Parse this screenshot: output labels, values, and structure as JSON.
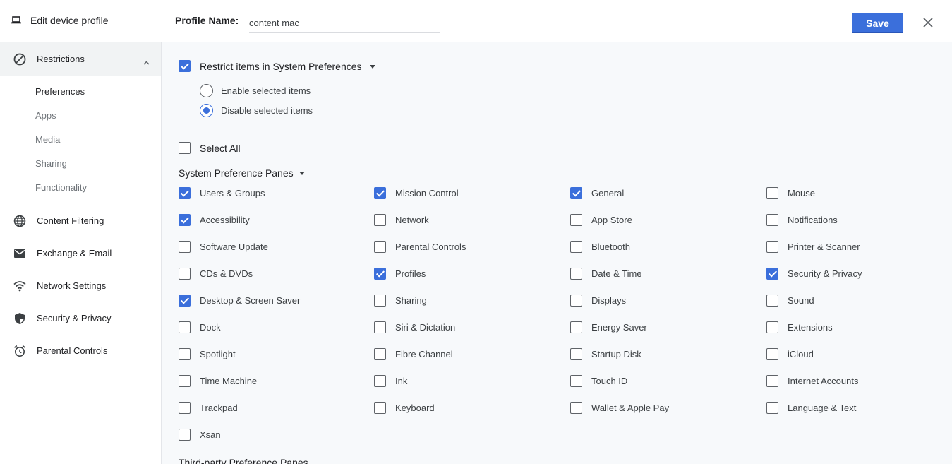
{
  "header": {
    "title": "Edit device profile",
    "profile_name_label": "Profile Name:",
    "profile_name_value": "content mac",
    "save_label": "Save"
  },
  "sidebar": {
    "section": "Restrictions",
    "sub_items": [
      "Preferences",
      "Apps",
      "Media",
      "Sharing",
      "Functionality"
    ],
    "active_sub_item": "Preferences",
    "items": [
      {
        "label": "Content Filtering",
        "icon": "globe-icon"
      },
      {
        "label": "Exchange & Email",
        "icon": "mail-icon"
      },
      {
        "label": "Network Settings",
        "icon": "wifi-icon"
      },
      {
        "label": "Security & Privacy",
        "icon": "shield-icon"
      },
      {
        "label": "Parental Controls",
        "icon": "alarm-clock-icon"
      }
    ]
  },
  "main": {
    "restrict_label": "Restrict items in System Preferences",
    "restrict_checked": true,
    "radio_options": [
      {
        "label": "Enable selected items",
        "selected": false
      },
      {
        "label": "Disable selected items",
        "selected": true
      }
    ],
    "select_all_label": "Select All",
    "select_all_checked": false,
    "system_panes_title": "System Preference Panes",
    "panes": [
      [
        "Users & Groups",
        true
      ],
      [
        "Mission Control",
        true
      ],
      [
        "General",
        true
      ],
      [
        "Mouse",
        false
      ],
      [
        "Accessibility",
        true
      ],
      [
        "Network",
        false
      ],
      [
        "App Store",
        false
      ],
      [
        "Notifications",
        false
      ],
      [
        "Software Update",
        false
      ],
      [
        "Parental Controls",
        false
      ],
      [
        "Bluetooth",
        false
      ],
      [
        "Printer & Scanner",
        false
      ],
      [
        "CDs & DVDs",
        false
      ],
      [
        "Profiles",
        true
      ],
      [
        "Date & Time",
        false
      ],
      [
        "Security & Privacy",
        true
      ],
      [
        "Desktop & Screen Saver",
        true
      ],
      [
        "Sharing",
        false
      ],
      [
        "Displays",
        false
      ],
      [
        "Sound",
        false
      ],
      [
        "Dock",
        false
      ],
      [
        "Siri & Dictation",
        false
      ],
      [
        "Energy Saver",
        false
      ],
      [
        "Extensions",
        false
      ],
      [
        "Spotlight",
        false
      ],
      [
        "Fibre Channel",
        false
      ],
      [
        "Startup Disk",
        false
      ],
      [
        "iCloud",
        false
      ],
      [
        "Time Machine",
        false
      ],
      [
        "Ink",
        false
      ],
      [
        "Touch ID",
        false
      ],
      [
        "Internet Accounts",
        false
      ],
      [
        "Trackpad",
        false
      ],
      [
        "Keyboard",
        false
      ],
      [
        "Wallet & Apple Pay",
        false
      ],
      [
        "Language & Text",
        false
      ],
      [
        "Xsan",
        false
      ]
    ],
    "third_party_title": "Third-party Preference Panes"
  },
  "colors": {
    "accent": "#3b6fdb",
    "main_bg": "#f7f9fb",
    "sidebar_active_bg": "#f1f3f4"
  }
}
